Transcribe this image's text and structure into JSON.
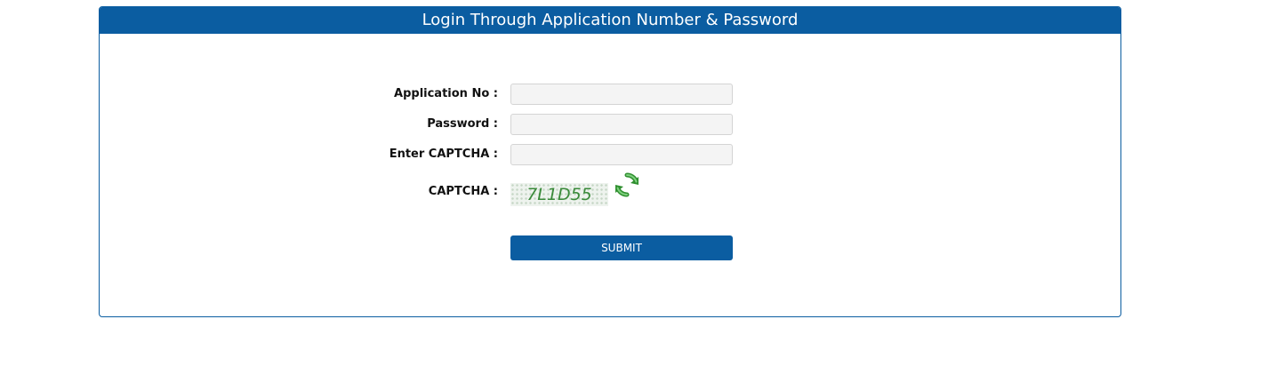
{
  "panel": {
    "title": "Login Through Application Number & Password"
  },
  "form": {
    "application_no": {
      "label": "Application No :",
      "value": "",
      "placeholder": ""
    },
    "password": {
      "label": "Password :",
      "value": "",
      "placeholder": ""
    },
    "captcha_input": {
      "label": "Enter CAPTCHA :",
      "value": "",
      "placeholder": ""
    },
    "captcha": {
      "label": "CAPTCHA :",
      "text": "7L1D55"
    },
    "submit_label": "SUBMIT"
  },
  "colors": {
    "primary": "#0b5da1",
    "captcha_text": "#3a8a3a",
    "refresh_icon": "#3aa43a"
  },
  "icons": {
    "refresh": "refresh-icon"
  }
}
